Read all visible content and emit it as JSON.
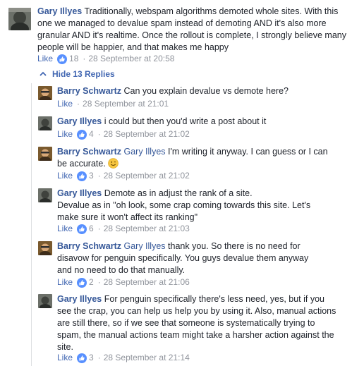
{
  "main_comment": {
    "author": "Gary Illyes",
    "text": "Traditionally, webspam algorithms demoted whole sites. With this one we managed to devalue spam instead of demoting AND it's also more granular AND it's realtime. Once the rollout is complete, I strongly believe many people will be happier, and that makes me happy",
    "like_label": "Like",
    "likes": "18",
    "timestamp": "28 September at 20:58"
  },
  "toggle": {
    "label": "Hide 13 Replies"
  },
  "replies": [
    {
      "author": "Barry Schwartz",
      "mention": "",
      "text": "Can you explain devalue vs demote here?",
      "like_label": "Like",
      "likes": "",
      "timestamp": "28 September at 21:01"
    },
    {
      "author": "Gary Illyes",
      "mention": "",
      "text": "i could but then you'd write a post about it",
      "like_label": "Like",
      "likes": "4",
      "timestamp": "28 September at 21:02"
    },
    {
      "author": "Barry Schwartz",
      "mention": "Gary Illyes",
      "text": "I'm writing it anyway. I can guess or I can be accurate.",
      "like_label": "Like",
      "likes": "3",
      "timestamp": "28 September at 21:02"
    },
    {
      "author": "Gary Illyes",
      "mention": "",
      "text": "Demote as in adjust the rank of a site.",
      "text2": "Devalue as in \"oh look, some crap coming towards this site. Let's make sure it won't affect its ranking\"",
      "like_label": "Like",
      "likes": "6",
      "timestamp": "28 September at 21:03"
    },
    {
      "author": "Barry Schwartz",
      "mention": "Gary Illyes",
      "text": "thank you. So there is no need for disavow for penguin specifically. You guys devalue them anyway and no need to do that manually.",
      "like_label": "Like",
      "likes": "2",
      "timestamp": "28 September at 21:06"
    },
    {
      "author": "Gary Illyes",
      "mention": "",
      "text": "For penguin specifically there's less need, yes, but if you see the crap, you can help us help you by using it. Also, manual actions are still there, so if we see that someone is systematically trying to spam, the manual actions team might take a harsher action against the site.",
      "like_label": "Like",
      "likes": "3",
      "timestamp": "28 September at 21:14"
    }
  ],
  "colors": {
    "link": "#365899",
    "like": "#4267b2",
    "meta": "#90949c",
    "thread_line": "#dddfe2"
  },
  "icons": {
    "like": "thumbs-up-icon",
    "toggle": "chevron-up-icon",
    "emoji": "smiley-emoji-icon"
  }
}
